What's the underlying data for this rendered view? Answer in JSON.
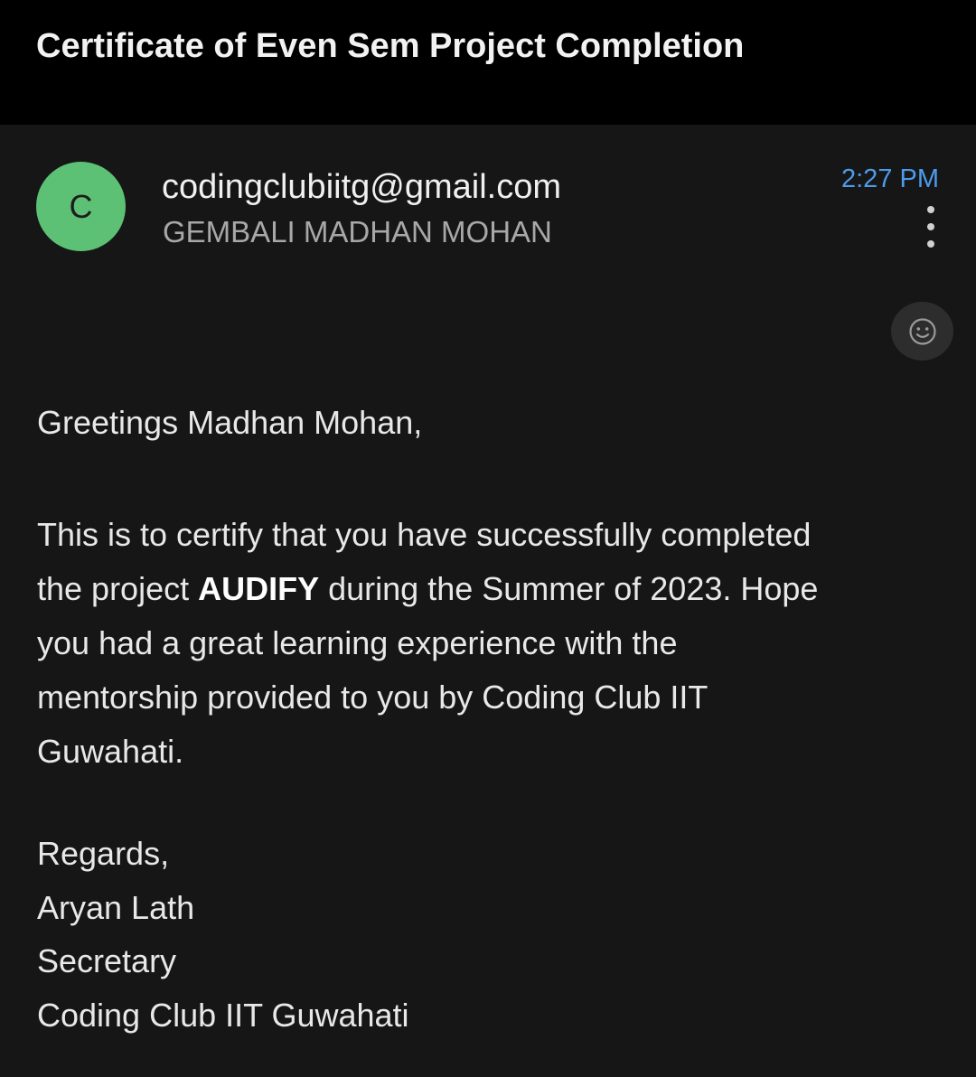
{
  "header": {
    "subject": "Certificate of Even Sem Project Completion"
  },
  "message": {
    "avatar_letter": "C",
    "sender_email": "codingclubiitg@gmail.com",
    "recipient": "GEMBALI MADHAN MOHAN",
    "time": "2:27 PM",
    "more_icon": "more-vert-icon",
    "reaction_icon": "add-reaction-icon"
  },
  "body": {
    "greeting": "Greetings Madhan Mohan,",
    "line1": "This is to certify that you have successfully completed",
    "line2_pre": "the project ",
    "project_name": "AUDIFY",
    "line2_post": " during the Summer of 2023. Hope",
    "line3": "you had a great learning experience with the",
    "line4": "mentorship provided to you by Coding Club IIT",
    "line5": "Guwahati.",
    "signoff": "Regards,",
    "signer_name": "Aryan Lath",
    "signer_title": "Secretary",
    "signer_org": "Coding Club IIT Guwahati"
  },
  "colors": {
    "avatar_bg": "#5cc174",
    "time_accent": "#4d9bea",
    "background": "#161616",
    "header_bg": "#000000"
  }
}
